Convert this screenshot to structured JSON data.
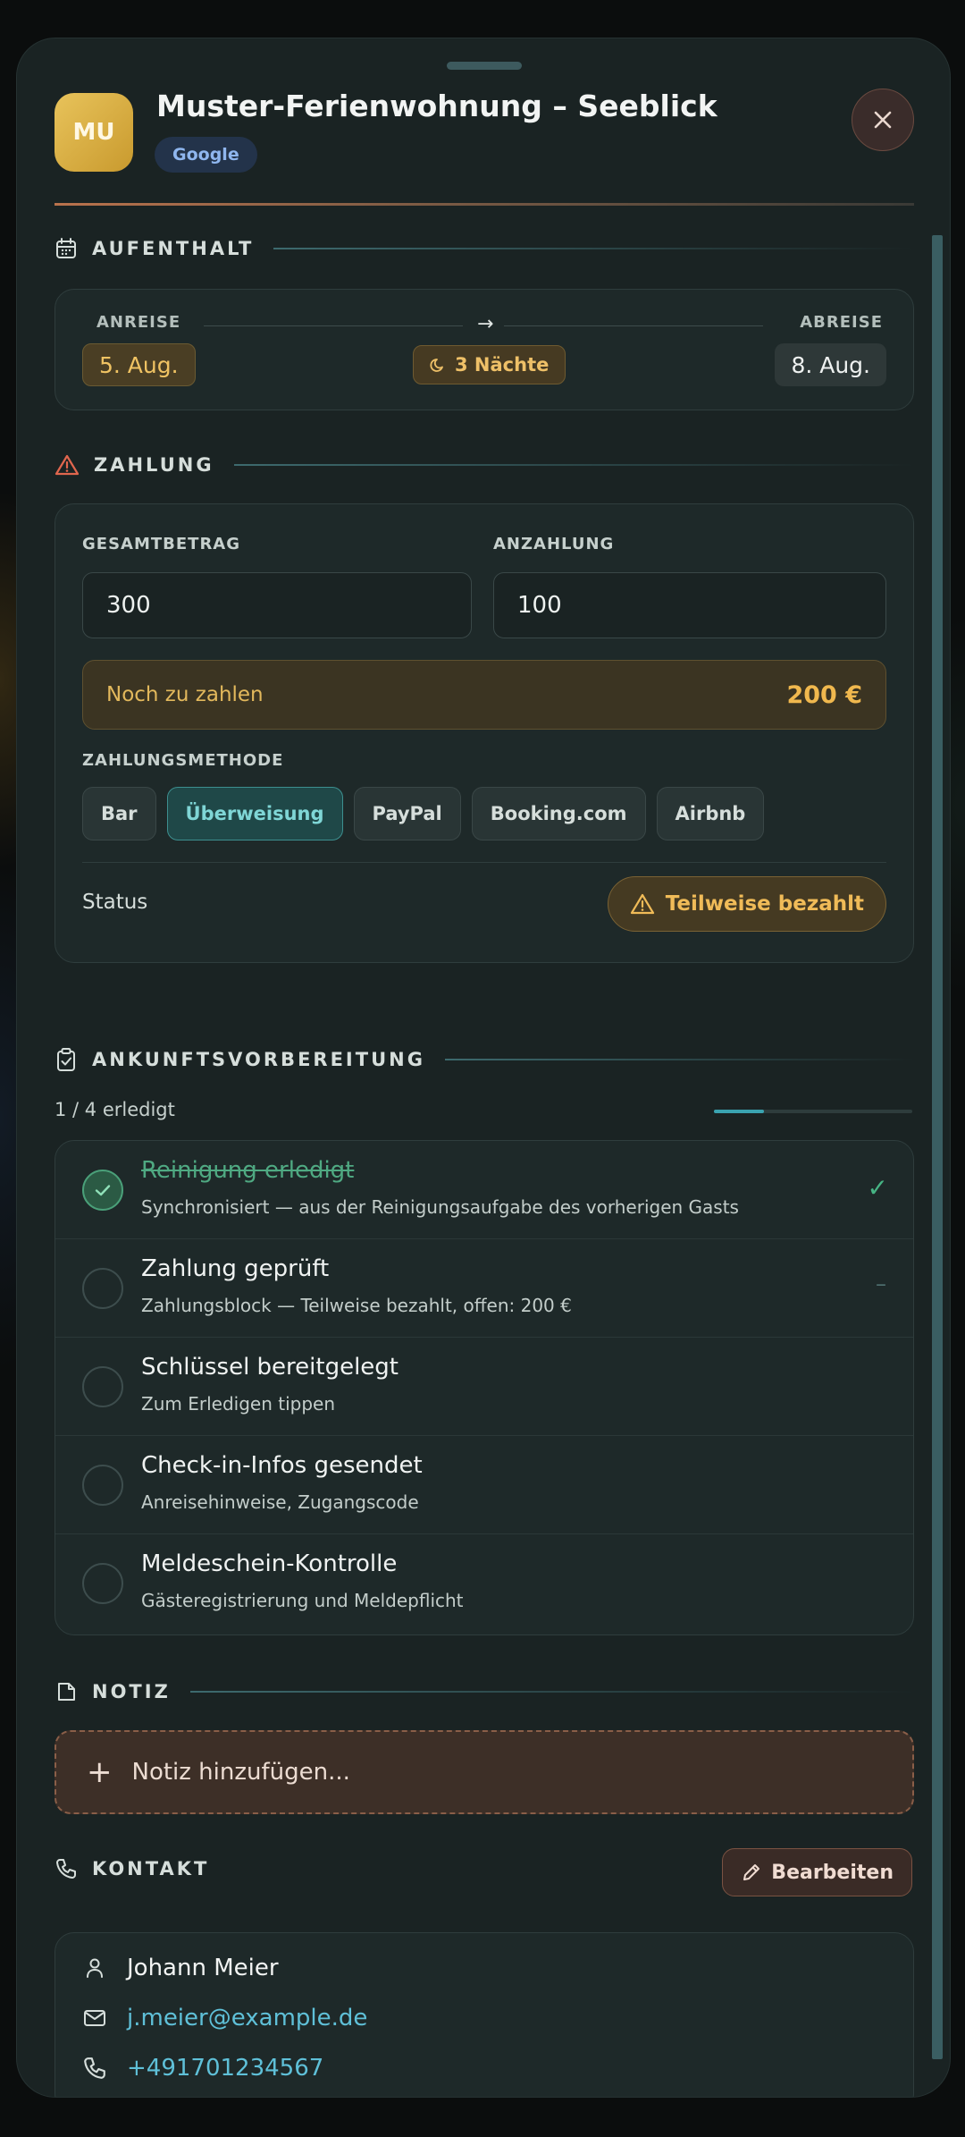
{
  "header": {
    "avatar_initials": "MU",
    "title": "Muster-Ferienwohnung – Seeblick",
    "source_badge": "Google"
  },
  "stay": {
    "section_label": "AUFENTHALT",
    "arrival_label": "ANREISE",
    "arrival_date": "5. Aug.",
    "departure_label": "ABREISE",
    "departure_date": "8. Aug.",
    "nights": "3 Nächte"
  },
  "payment": {
    "section_label": "ZAHLUNG",
    "total_label": "GESAMTBETRAG",
    "total_value": "300",
    "deposit_label": "ANZAHLUNG",
    "deposit_value": "100",
    "due_label": "Noch zu zahlen",
    "due_amount": "200 €",
    "method_label": "ZAHLUNGSMETHODE",
    "methods": [
      {
        "label": "Bar",
        "active": false
      },
      {
        "label": "Überweisung",
        "active": true
      },
      {
        "label": "PayPal",
        "active": false
      },
      {
        "label": "Booking.com",
        "active": false
      },
      {
        "label": "Airbnb",
        "active": false
      }
    ],
    "status_label": "Status",
    "status_value": "Teilweise bezahlt"
  },
  "arrival_prep": {
    "section_label": "ANKUNFTSVORBEREITUNG",
    "progress_text": "1 / 4 erledigt",
    "progress_fraction": 0.25,
    "items": [
      {
        "title": "Reinigung erledigt",
        "subtitle": "Synchronisiert — aus der Reinigungsaufgabe des vorherigen Gasts",
        "done": true,
        "trailing": "✓"
      },
      {
        "title": "Zahlung geprüft",
        "subtitle": "Zahlungsblock — Teilweise bezahlt, offen: 200 €",
        "done": false,
        "trailing": "–"
      },
      {
        "title": "Schlüssel bereitgelegt",
        "subtitle": "Zum Erledigen tippen",
        "done": false,
        "trailing": ""
      },
      {
        "title": "Check-in-Infos gesendet",
        "subtitle": "Anreisehinweise, Zugangscode",
        "done": false,
        "trailing": ""
      },
      {
        "title": "Meldeschein-Kontrolle",
        "subtitle": "Gästeregistrierung und Meldepflicht",
        "done": false,
        "trailing": ""
      }
    ]
  },
  "note": {
    "section_label": "NOTIZ",
    "add_label": "Notiz hinzufügen..."
  },
  "contact": {
    "section_label": "KONTAKT",
    "edit_label": "Bearbeiten",
    "name": "Johann Meier",
    "email": "j.meier@example.de",
    "phone": "+491701234567"
  },
  "colors": {
    "accent_teal": "#3aa3b0",
    "warning_amber": "#f0b84e",
    "done_green": "#4fa982",
    "alert_red": "#e0664e"
  },
  "icons": {
    "stay": "calendar-icon",
    "payment": "warning-icon",
    "arrival": "clipboard-check-icon",
    "note": "note-icon",
    "contact": "phone-icon",
    "close": "close-icon"
  }
}
